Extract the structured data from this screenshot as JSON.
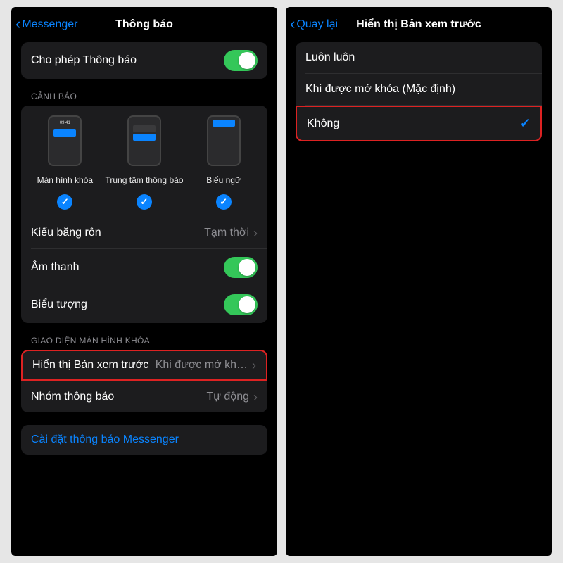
{
  "left": {
    "back_label": "Messenger",
    "title": "Thông báo",
    "allow_label": "Cho phép Thông báo",
    "section_alerts": "CẢNH BÁO",
    "opt_lock": "Màn hình khóa",
    "opt_nc": "Trung tâm thông báo",
    "opt_banner": "Biểu ngữ",
    "banner_style_label": "Kiểu băng rôn",
    "banner_style_value": "Tạm thời",
    "sound_label": "Âm thanh",
    "badges_label": "Biểu tượng",
    "section_lockscreen": "GIAO DIỆN MÀN HÌNH KHÓA",
    "preview_label": "Hiển thị Bản xem trước",
    "preview_value": "Khi được mở kh…",
    "grouping_label": "Nhóm thông báo",
    "grouping_value": "Tự động",
    "messenger_settings": "Cài đặt thông báo Messenger"
  },
  "right": {
    "back_label": "Quay lại",
    "title": "Hiển thị Bản xem trước",
    "opt_always": "Luôn luôn",
    "opt_unlocked": "Khi được mở khóa (Mặc định)",
    "opt_never": "Không"
  }
}
